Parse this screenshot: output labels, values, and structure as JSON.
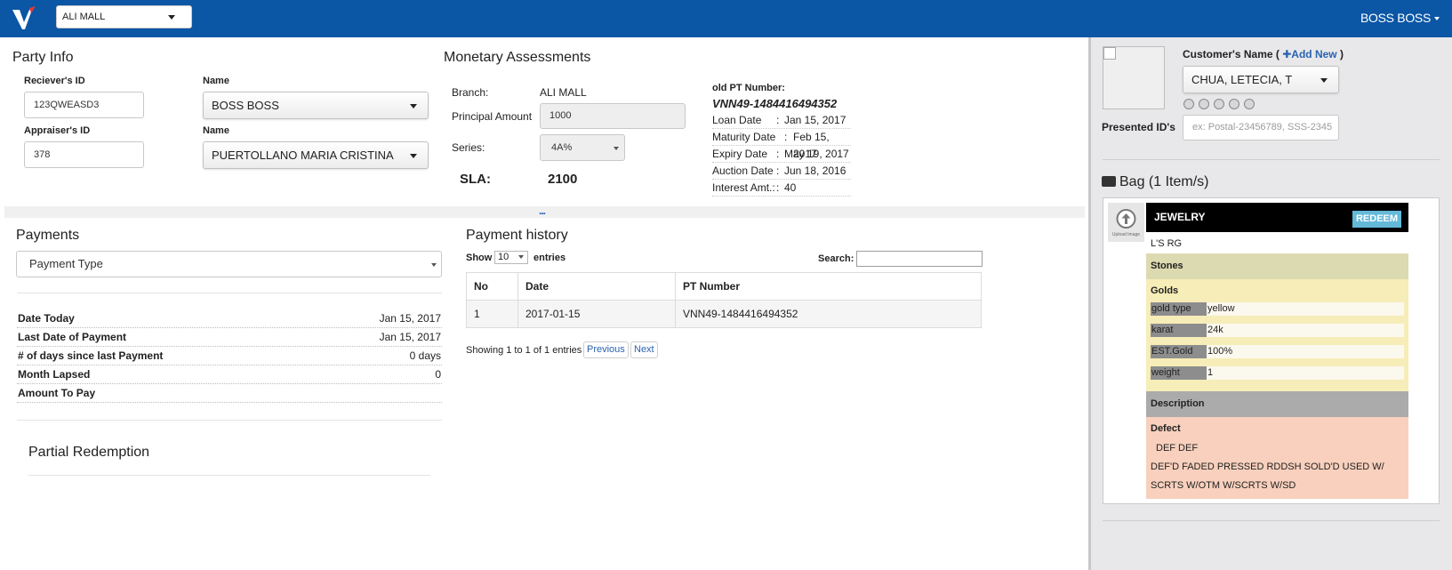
{
  "header": {
    "branch_selected": "ALI MALL",
    "user_name": "BOSS BOSS"
  },
  "party_info": {
    "title": "Party Info",
    "receiver_id_label": "Reciever's ID",
    "receiver_id_value": "123QWEASD3",
    "receiver_name_label": "Name",
    "receiver_name_value": "BOSS BOSS",
    "appraiser_id_label": "Appraiser's ID",
    "appraiser_id_value": "378",
    "appraiser_name_label": "Name",
    "appraiser_name_value": "PUERTOLLANO MARIA CRISTINA"
  },
  "monetary": {
    "title": "Monetary Assessments",
    "branch_label": "Branch:",
    "branch_value": "ALI MALL",
    "principal_label": "Principal Amount",
    "principal_value": "1000",
    "series_label": "Series:",
    "series_value": "4A%",
    "sla_label": "SLA:",
    "sla_value": "2100"
  },
  "old_pt": {
    "label": "old PT Number:",
    "number": "VNN49-1484416494352",
    "rows": [
      {
        "label": "Loan Date",
        "sep": " : ",
        "value": "Jan 15, 2017"
      },
      {
        "label": "Maturity Date",
        "sep": " : ",
        "value": "Feb 15, 2017"
      },
      {
        "label": "Expiry Date",
        "sep": " : ",
        "value": "May 19, 2017"
      },
      {
        "label": "Auction Date",
        "sep": " : ",
        "value": "Jun 18, 2016"
      },
      {
        "label": "Interest Amt.:",
        "sep": " : ",
        "value": "40"
      }
    ]
  },
  "divider": {
    "dots": "..."
  },
  "payments": {
    "title": "Payments",
    "type_placeholder": "Payment Type",
    "summary": [
      {
        "label": "Date Today",
        "value": "Jan 15, 2017"
      },
      {
        "label": "Last Date of Payment",
        "value": "Jan 15, 2017"
      },
      {
        "label": "# of days since last Payment",
        "value": "0 days"
      },
      {
        "label": "Month Lapsed",
        "value": "0"
      },
      {
        "label": "Amount To Pay",
        "value": ""
      }
    ],
    "partial_title": "Partial Redemption"
  },
  "history": {
    "title": "Payment history",
    "show_label": "Show",
    "page_size": "10",
    "entries_label": "entries",
    "search_label": "Search:",
    "columns": [
      "No",
      "Date",
      "PT Number"
    ],
    "rows": [
      [
        "1",
        "2017-01-15",
        "VNN49-1484416494352"
      ]
    ],
    "info": "Showing 1 to 1 of 1 entries",
    "prev_label": "Previous",
    "next_label": "Next"
  },
  "customer": {
    "name_label": "Customer's Name (",
    "add_new_label": "Add New",
    "name_label_close": " )",
    "name_value": "CHUA, LETECIA, T",
    "presented_ids_label": "Presented ID's",
    "presented_ids_placeholder": "ex: Postal-23456789, SSS-2345"
  },
  "bag": {
    "title": "Bag (1 Item/s)",
    "upload_label": "Upload Image",
    "item_category": "JEWELRY",
    "redeem_label": "REDEEM",
    "item_name": "L'S RG",
    "stones_label": "Stones",
    "golds_label": "Golds",
    "golds": [
      {
        "key": "gold type",
        "value": "yellow"
      },
      {
        "key": "karat",
        "value": "24k"
      },
      {
        "key": "EST.Gold",
        "value": "100%"
      },
      {
        "key": "weight",
        "value": "1"
      }
    ],
    "description_label": "Description",
    "defect_label": "Defect",
    "defect_codes": "DEF DEF",
    "defect_line1": "DEF'D FADED PRESSED RDDSH SOLD'D USED W/",
    "defect_line2": "SCRTS W/OTM W/SCRTS W/SD"
  },
  "colors": {
    "navbar": "#0b56a5",
    "link": "#2a62b0",
    "redeem": "#64b9d9",
    "stones_bg": "#dcdab0",
    "golds_bg": "#f7edb8",
    "description_bg": "#ababab",
    "defect_bg": "#f8d0bd"
  }
}
